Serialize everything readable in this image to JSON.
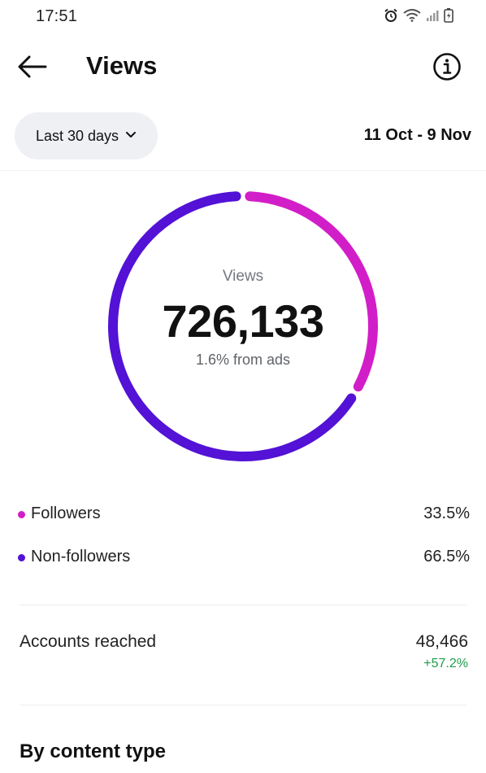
{
  "status_bar": {
    "time": "17:51",
    "icons": [
      "alarm-icon",
      "wifi-icon",
      "signal-icon",
      "battery-icon"
    ]
  },
  "header": {
    "title": "Views",
    "back_icon": "arrow-left-icon",
    "info_icon": "info-icon"
  },
  "filter": {
    "range_label": "Last 30 days",
    "dropdown_icon": "chevron-down-icon",
    "date_range": "11 Oct - 9 Nov"
  },
  "summary": {
    "label": "Views",
    "total": "726,133",
    "ads_note": "1.6% from ads"
  },
  "chart_data": {
    "type": "pie",
    "title": "",
    "categories": [
      "Followers",
      "Non-followers"
    ],
    "values": [
      33.5,
      66.5
    ],
    "colors": [
      "#d21ec8",
      "#5312d6"
    ],
    "unit": "%"
  },
  "legend": [
    {
      "label": "Followers",
      "value": "33.5%",
      "color": "#d21ec8"
    },
    {
      "label": "Non-followers",
      "value": "66.5%",
      "color": "#5312d6"
    }
  ],
  "accounts_reached": {
    "label": "Accounts reached",
    "value": "48,466",
    "change": "+57.2%",
    "change_color": "#1f9d4a"
  },
  "sections": {
    "content_type_title": "By content type"
  }
}
